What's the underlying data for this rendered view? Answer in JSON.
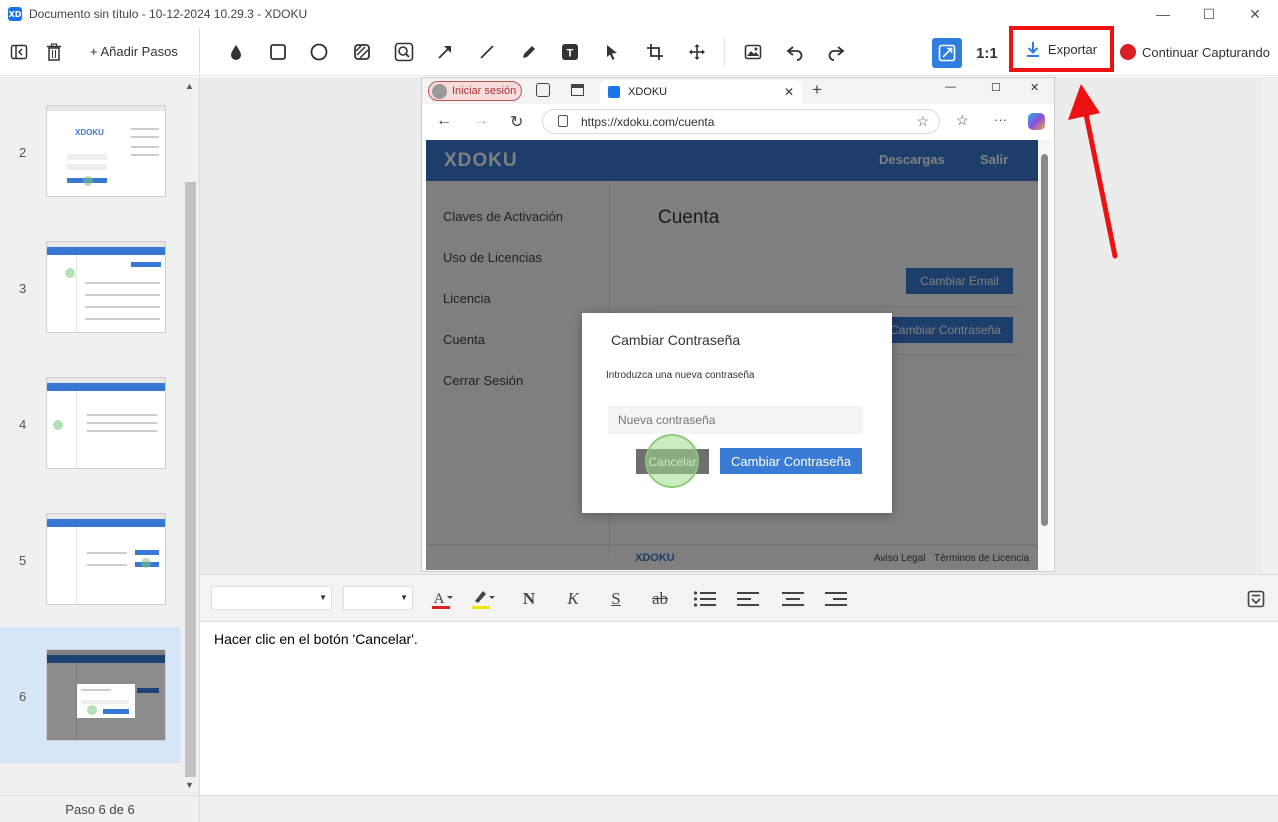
{
  "window": {
    "app_logo": "XD",
    "title": "Documento sin título - 10-12-2024 10.29.3 - XDOKU",
    "controls": [
      "—",
      "☐",
      "✕"
    ]
  },
  "toolbar": {
    "add_steps": "+ Añadir Pasos",
    "zoom_label": "1:1",
    "export_label": "Exportar",
    "capture_label": "Continuar Capturando",
    "tools": [
      "drop-icon",
      "rectangle-icon",
      "circle-icon",
      "hatch-icon",
      "magnifier-icon",
      "arrow-icon",
      "line-icon",
      "pen-icon",
      "text-icon",
      "pointer-icon",
      "crop-icon",
      "move-icon",
      "image-icon",
      "undo-icon",
      "redo-icon"
    ],
    "highlight_color": "#ee1111"
  },
  "steps": {
    "items": [
      {
        "num": "2"
      },
      {
        "num": "3"
      },
      {
        "num": "4"
      },
      {
        "num": "5"
      },
      {
        "num": "6"
      }
    ],
    "counter": "Paso 6 de 6"
  },
  "browser": {
    "signin": "Iniciar sesión",
    "tab_title": "XDOKU",
    "url": "https://xdoku.com/cuenta",
    "site": {
      "logo": "XDOKU",
      "nav": [
        "Descargas",
        "Salir"
      ],
      "sidebar": [
        "Claves de Activación",
        "Uso de Licencias",
        "Licencia",
        "Cuenta",
        "Cerrar Sesión"
      ],
      "page_title": "Cuenta",
      "btn_email": "Cambiar Email",
      "btn_password": "Cambiar Contraseña",
      "footer_logo": "XDOKU",
      "footer_links": [
        "Aviso Legal",
        "Términos de Licencia"
      ]
    },
    "modal": {
      "title": "Cambiar Contraseña",
      "text": "Introduzca una nueva contraseña",
      "placeholder": "Nueva contraseña",
      "cancel": "Cancelar",
      "confirm": "Cambiar Contraseña"
    }
  },
  "editor": {
    "text": "Hacer clic en el botón 'Cancelar'."
  },
  "colors": {
    "accent": "#2f7de1",
    "site_blue": "#3a7bd5",
    "text_color_swatch": "#e02020",
    "highlight_swatch": "#f2e500"
  }
}
